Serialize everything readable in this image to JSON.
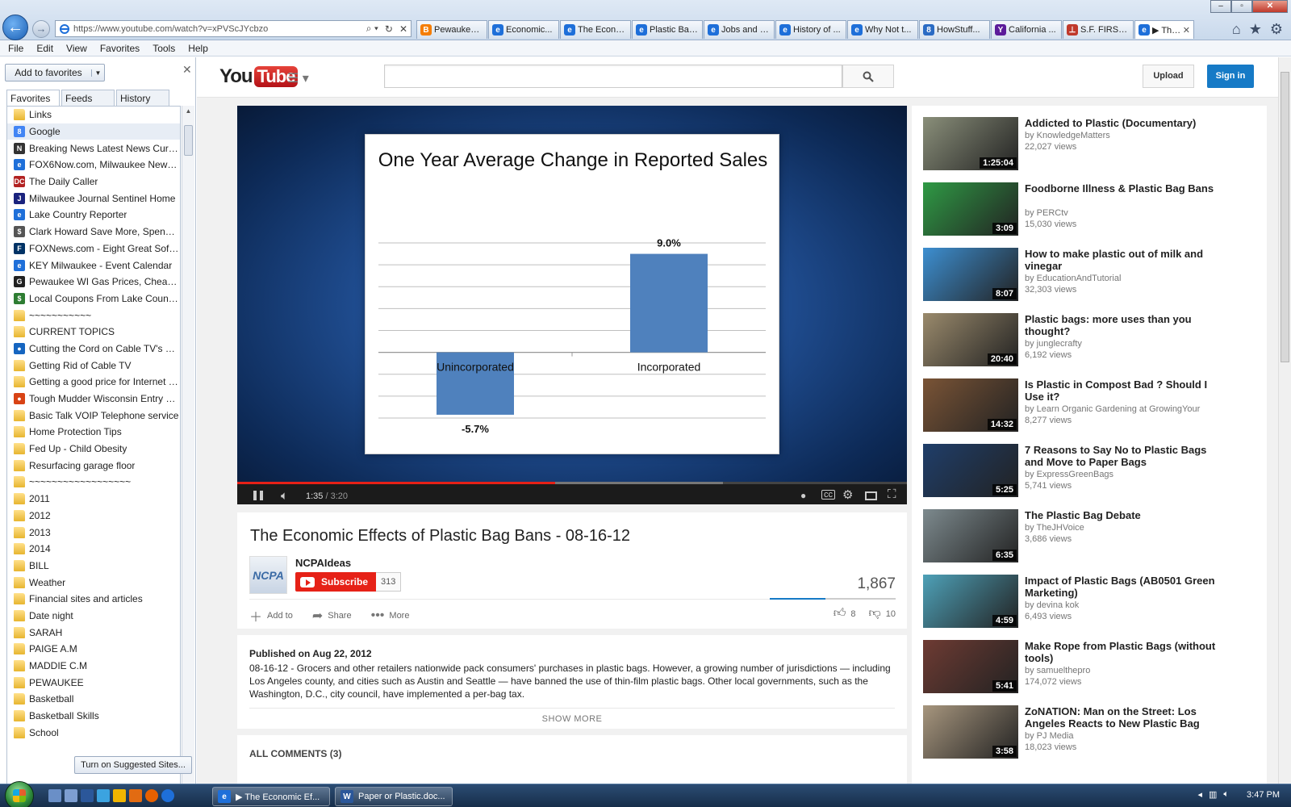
{
  "browser": {
    "url": "https://www.youtube.com/watch?v=xPVScJYcbzo",
    "address_controls": [
      "⌕ ▾",
      "↻",
      "✕"
    ],
    "tabs": [
      {
        "label": "Pewaukee ...",
        "icon_letter": "B",
        "icon_color": "#f57d00"
      },
      {
        "label": "Economic...",
        "icon_letter": "e",
        "icon_color": "#1e6fd9"
      },
      {
        "label": "The Econo...",
        "icon_letter": "e",
        "icon_color": "#1e6fd9"
      },
      {
        "label": "Plastic Bag...",
        "icon_letter": "e",
        "icon_color": "#1e6fd9"
      },
      {
        "label": "Jobs and E...",
        "icon_letter": "e",
        "icon_color": "#1e6fd9"
      },
      {
        "label": "History of ...",
        "icon_letter": "e",
        "icon_color": "#1e6fd9"
      },
      {
        "label": "Why Not t...",
        "icon_letter": "e",
        "icon_color": "#1e6fd9"
      },
      {
        "label": "HowStuff...",
        "icon_letter": "8",
        "icon_color": "#2a6bc4"
      },
      {
        "label": "California ...",
        "icon_letter": "Y",
        "icon_color": "#5c1c9a"
      },
      {
        "label": "S.F. FIRST ...",
        "icon_letter": "⊥",
        "icon_color": "#c0392b"
      },
      {
        "label": "▶ The ...",
        "icon_letter": "e",
        "icon_color": "#1e6fd9",
        "active": true
      }
    ],
    "menu": [
      "File",
      "Edit",
      "View",
      "Favorites",
      "Tools",
      "Help"
    ]
  },
  "favorites": {
    "add_label": "Add to favorites",
    "tabs": [
      "Favorites",
      "Feeds",
      "History"
    ],
    "suggested_label": "Turn on Suggested Sites...",
    "items": [
      {
        "label": "Links",
        "type": "folder"
      },
      {
        "label": "Google",
        "type": "site",
        "color": "#4285f4",
        "letter": "8",
        "highlight": true
      },
      {
        "label": "Breaking News  Latest News  Curren...",
        "type": "site",
        "color": "#333",
        "letter": "N"
      },
      {
        "label": "FOX6Now.com, Milwaukee News, ...",
        "type": "site",
        "color": "#1e6fd9",
        "letter": "e"
      },
      {
        "label": "The Daily Caller",
        "type": "site",
        "color": "#b22222",
        "letter": "DC"
      },
      {
        "label": "Milwaukee Journal Sentinel Home",
        "type": "site",
        "color": "#1a237e",
        "letter": "J"
      },
      {
        "label": "Lake Country Reporter",
        "type": "site",
        "color": "#1e6fd9",
        "letter": "e"
      },
      {
        "label": "Clark Howard Save More, Spend Les...",
        "type": "site",
        "color": "#555",
        "letter": "$"
      },
      {
        "label": "FOXNews.com - Eight Great Softwar...",
        "type": "site",
        "color": "#003366",
        "letter": "F"
      },
      {
        "label": "KEY Milwaukee - Event Calendar",
        "type": "site",
        "color": "#1e6fd9",
        "letter": "e"
      },
      {
        "label": "Pewaukee WI Gas Prices, Cheap Gas...",
        "type": "site",
        "color": "#222",
        "letter": "G"
      },
      {
        "label": "Local Coupons From Lake Country ...",
        "type": "site",
        "color": "#2e7d32",
        "letter": "$"
      },
      {
        "label": "~~~~~~~~~~~",
        "type": "folder"
      },
      {
        "label": "CURRENT TOPICS",
        "type": "folder"
      },
      {
        "label": "Cutting the Cord on Cable TV's Pric...",
        "type": "site",
        "color": "#1565c0",
        "letter": "●"
      },
      {
        "label": "Getting Rid of Cable TV",
        "type": "folder"
      },
      {
        "label": "Getting a good price for Internet - C...",
        "type": "folder"
      },
      {
        "label": "Tough Mudder Wisconsin Entry Pac...",
        "type": "site",
        "color": "#d84315",
        "letter": "●"
      },
      {
        "label": "Basic Talk VOIP Telephone service",
        "type": "folder"
      },
      {
        "label": "Home Protection Tips",
        "type": "folder"
      },
      {
        "label": "Fed Up - Child Obesity",
        "type": "folder"
      },
      {
        "label": "Resurfacing garage floor",
        "type": "folder"
      },
      {
        "label": "~~~~~~~~~~~~~~~~~~",
        "type": "folder"
      },
      {
        "label": "2011",
        "type": "folder"
      },
      {
        "label": "2012",
        "type": "folder"
      },
      {
        "label": "2013",
        "type": "folder"
      },
      {
        "label": "2014",
        "type": "folder"
      },
      {
        "label": "BILL",
        "type": "folder"
      },
      {
        "label": "Weather",
        "type": "folder"
      },
      {
        "label": "Financial sites and articles",
        "type": "folder"
      },
      {
        "label": "Date night",
        "type": "folder"
      },
      {
        "label": "SARAH",
        "type": "folder"
      },
      {
        "label": "PAIGE A.M",
        "type": "folder"
      },
      {
        "label": "MADDIE C.M",
        "type": "folder"
      },
      {
        "label": "PEWAUKEE",
        "type": "folder"
      },
      {
        "label": "Basketball",
        "type": "folder"
      },
      {
        "label": "Basketball Skills",
        "type": "folder"
      },
      {
        "label": "School",
        "type": "folder"
      }
    ]
  },
  "youtube": {
    "logo_you": "You",
    "logo_tube": "Tube",
    "upload_label": "Upload",
    "signin_label": "Sign in",
    "player": {
      "time_current": "1:35",
      "time_sep": " / ",
      "time_total": "3:20",
      "played_fraction": 0.475,
      "buffered_fraction": 0.725
    },
    "video": {
      "title": "The Economic Effects of Plastic Bag Bans - 08-16-12",
      "channel": "NCPAIdeas",
      "channel_avatar_text": "NCPA",
      "subscribe_label": "Subscribe",
      "subscriber_count": "313",
      "views": "1,867",
      "like_fraction": 0.44,
      "likes": "8",
      "dislikes": "10",
      "actions": {
        "add": "Add to",
        "share": "Share",
        "more": "More"
      },
      "published": "Published on Aug 22, 2012",
      "description": "08-16-12 - Grocers and other retailers nationwide pack consumers' purchases in plastic bags. However, a growing number of jurisdictions — including Los Angeles county, and cities such as Austin and Seattle — have banned the use of thin-film plastic bags. Other local governments, such as the Washington, D.C., city council, have implemented a per-bag tax.",
      "show_more": "SHOW MORE",
      "comments_header": "ALL COMMENTS (3)"
    },
    "related": [
      {
        "title": "Addicted to Plastic (Documentary)",
        "by": "by KnowledgeMatters",
        "views": "22,027 views",
        "duration": "1:25:04",
        "color": "#8a8f7a"
      },
      {
        "title": "Foodborne Illness & Plastic Bag Bans",
        "by": "by PERCtv",
        "views": "15,030 views",
        "duration": "3:09",
        "color": "#2f9a45"
      },
      {
        "title": "How to make plastic out of milk and vinegar",
        "by": "by EducationAndTutorial",
        "views": "32,303 views",
        "duration": "8:07",
        "color": "#3d8fd1"
      },
      {
        "title": "Plastic bags: more uses than you thought?",
        "by": "by junglecrafty",
        "views": "6,192 views",
        "duration": "20:40",
        "color": "#9a8a6c"
      },
      {
        "title": "Is Plastic in Compost Bad ? Should I Use it?",
        "by": "by Learn Organic Gardening at GrowingYour",
        "views": "8,277 views",
        "duration": "14:32",
        "color": "#7a5436"
      },
      {
        "title": "7 Reasons to Say No to Plastic Bags and Move to Paper Bags",
        "by": "by ExpressGreenBags",
        "views": "5,741 views",
        "duration": "5:25",
        "color": "#1f3e6a"
      },
      {
        "title": "The Plastic Bag Debate",
        "by": "by TheJHVoice",
        "views": "3,686 views",
        "duration": "6:35",
        "color": "#7d8a8e"
      },
      {
        "title": "Impact of Plastic Bags (AB0501 Green Marketing)",
        "by": "by devina kok",
        "views": "6,493 views",
        "duration": "4:59",
        "color": "#4ea1b8"
      },
      {
        "title": "Make Rope from Plastic Bags (without tools)",
        "by": "by samuelthepro",
        "views": "174,072 views",
        "duration": "5:41",
        "color": "#6e3b33"
      },
      {
        "title": "ZoNATION: Man on the Street: Los Angeles Reacts to New Plastic Bag",
        "by": "by PJ Media",
        "views": "18,023 views",
        "duration": "3:58",
        "color": "#a7967e"
      }
    ]
  },
  "slide_chart": {
    "chart_data": {
      "type": "bar",
      "title": "One Year Average Change in Reported Sales",
      "categories": [
        "Unincorporated",
        "Incorporated"
      ],
      "values": [
        -5.7,
        9.0
      ],
      "data_labels": [
        "-5.7%",
        "9.0%"
      ],
      "ylim": [
        -6,
        10
      ],
      "grid": true,
      "bar_color": "#4f81bd"
    }
  },
  "taskbar": {
    "tasks": [
      {
        "label": "▶ The Economic Ef...",
        "icon_letter": "e",
        "icon_color": "#1e6fd9"
      },
      {
        "label": "Paper or Plastic.doc...",
        "icon_letter": "W",
        "icon_color": "#2b579a"
      }
    ],
    "clock": "3:47 PM"
  }
}
